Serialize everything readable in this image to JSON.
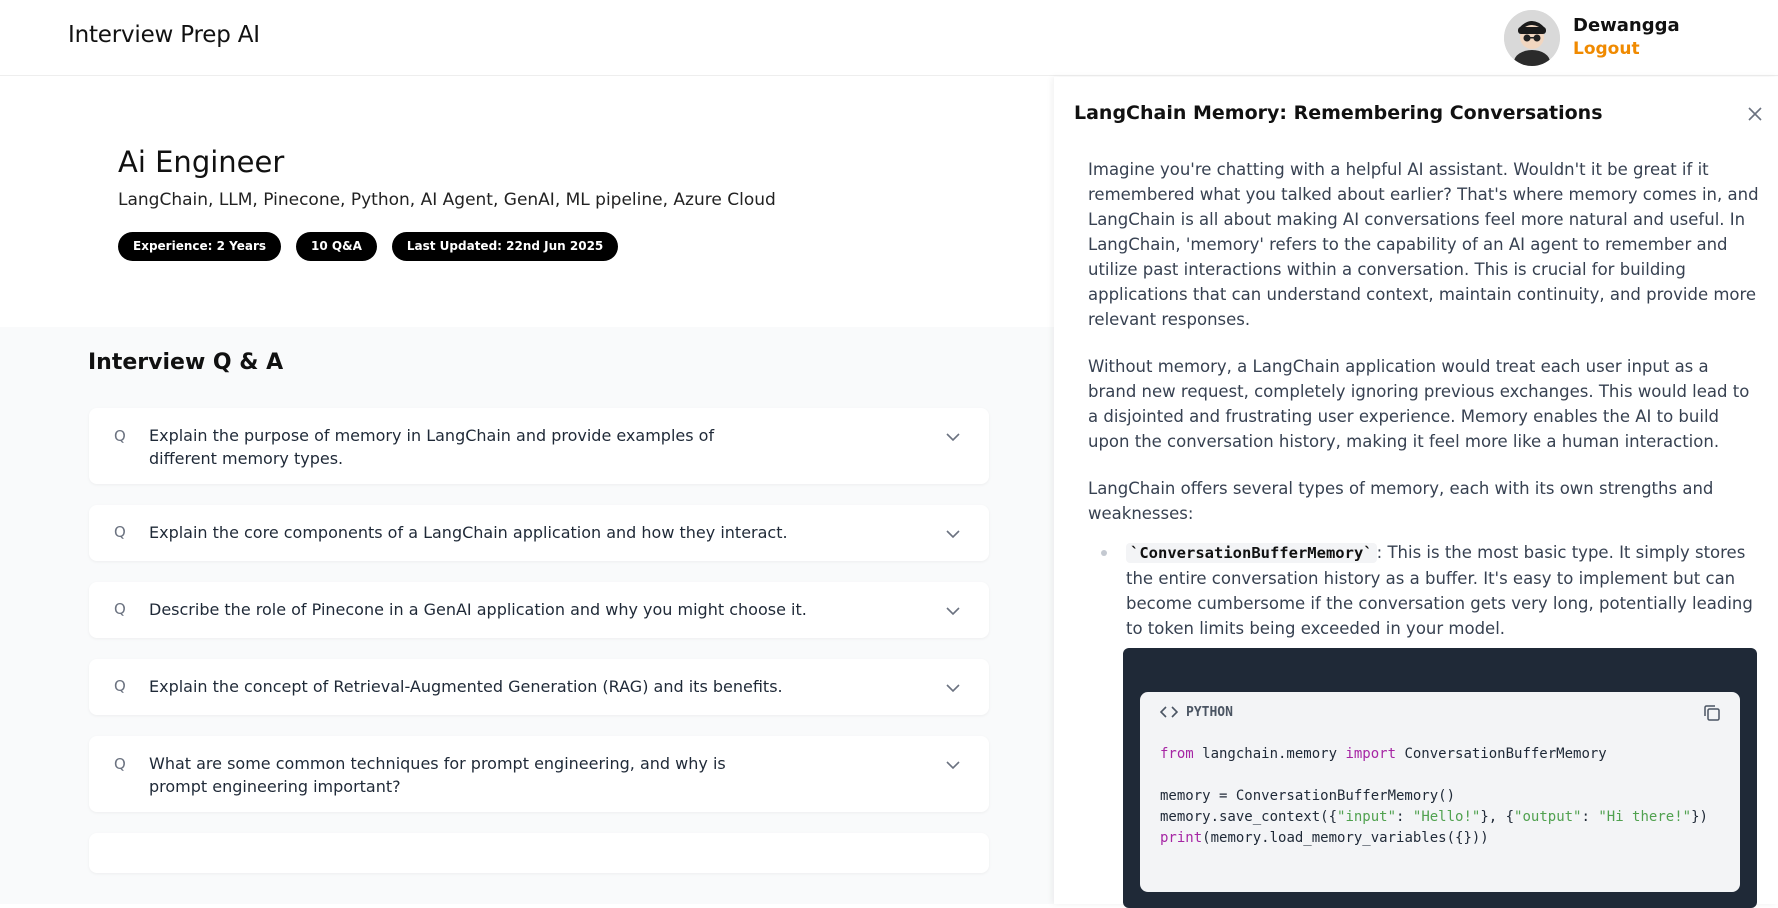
{
  "header": {
    "app_title": "Interview Prep AI",
    "user_name": "Dewangga",
    "logout_label": "Logout"
  },
  "session": {
    "role": "Ai Engineer",
    "topics": "LangChain, LLM, Pinecone, Python, AI Agent, GenAI, ML pipeline, Azure Cloud",
    "tags": [
      "Experience: 2 Years",
      "10 Q&A",
      "Last Updated: 22nd Jun 2025"
    ]
  },
  "qa": {
    "heading": "Interview Q & A",
    "q_marker": "Q",
    "questions": [
      "Explain the purpose of memory in LangChain and provide examples of different memory types.",
      "Explain the core components of a LangChain application and how they interact.",
      "Describe the role of Pinecone in a GenAI application and why you might choose it.",
      "Explain the concept of Retrieval-Augmented Generation (RAG) and its benefits.",
      "What are some common techniques for prompt engineering, and why is prompt engineering important?"
    ]
  },
  "drawer": {
    "title": "LangChain Memory: Remembering Conversations",
    "paragraphs": [
      "Imagine you're chatting with a helpful AI assistant. Wouldn't it be great if it remembered what you talked about earlier? That's where memory comes in, and LangChain is all about making AI conversations feel more natural and useful. In LangChain, 'memory' refers to the capability of an AI agent to remember and utilize past interactions within a conversation. This is crucial for building applications that can understand context, maintain continuity, and provide more relevant responses.",
      "Without memory, a LangChain application would treat each user input as a brand new request, completely ignoring previous exchanges. This would lead to a disjointed and frustrating user experience. Memory enables the AI to build upon the conversation history, making it feel more like a human interaction.",
      "LangChain offers several types of memory, each with its own strengths and weaknesses:"
    ],
    "bullet_code": "`ConversationBufferMemory`",
    "bullet_text": ": This is the most basic type. It simply stores the entire conversation history as a buffer. It's easy to implement but can become cumbersome if the conversation gets very long, potentially leading to token limits being exceeded in your model.",
    "code_lang": "PYTHON",
    "code_lines": {
      "l1_kw1": "from",
      "l1_mod": " langchain.memory ",
      "l1_kw2": "import",
      "l1_cls": " ConversationBufferMemory",
      "l3": "memory = ConversationBufferMemory()",
      "l4_a": "memory.save_context({",
      "l4_s1": "\"input\"",
      "l4_b": ": ",
      "l4_s2": "\"Hello!\"",
      "l4_c": "}, {",
      "l4_s3": "\"output\"",
      "l4_d": ": ",
      "l4_s4": "\"Hi there!\"",
      "l4_e": "})",
      "l5_fn": "print",
      "l5_rest": "(memory.load_memory_variables({}))"
    }
  }
}
